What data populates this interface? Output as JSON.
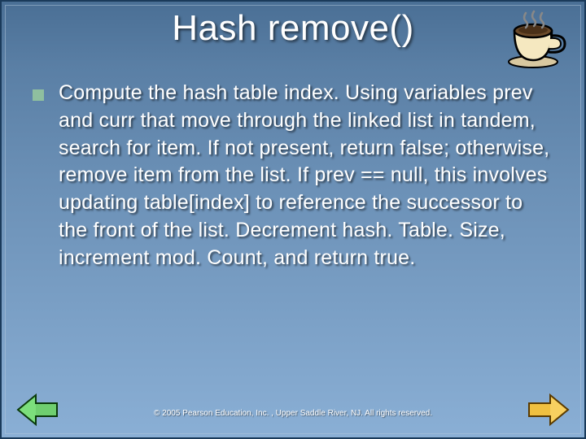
{
  "title": "Hash remove()",
  "body": "Compute the hash table index. Using variables prev and curr that move through the linked list in tandem, search for item. If not present, return false; otherwise, remove item from the list. If prev == null, this involves updating table[index] to reference the successor to the front of the list. Decrement hash. Table. Size, increment mod. Count, and return true.",
  "footer": "© 2005 Pearson Education, Inc. , Upper Saddle River, NJ.  All rights reserved.",
  "icons": {
    "coffee": "coffee-cup-icon",
    "prev": "arrow-left-icon",
    "next": "arrow-right-icon"
  },
  "colors": {
    "bullet": "#8fbf9f",
    "nav_prev": "#6fcf6f",
    "nav_next": "#f0c040"
  }
}
